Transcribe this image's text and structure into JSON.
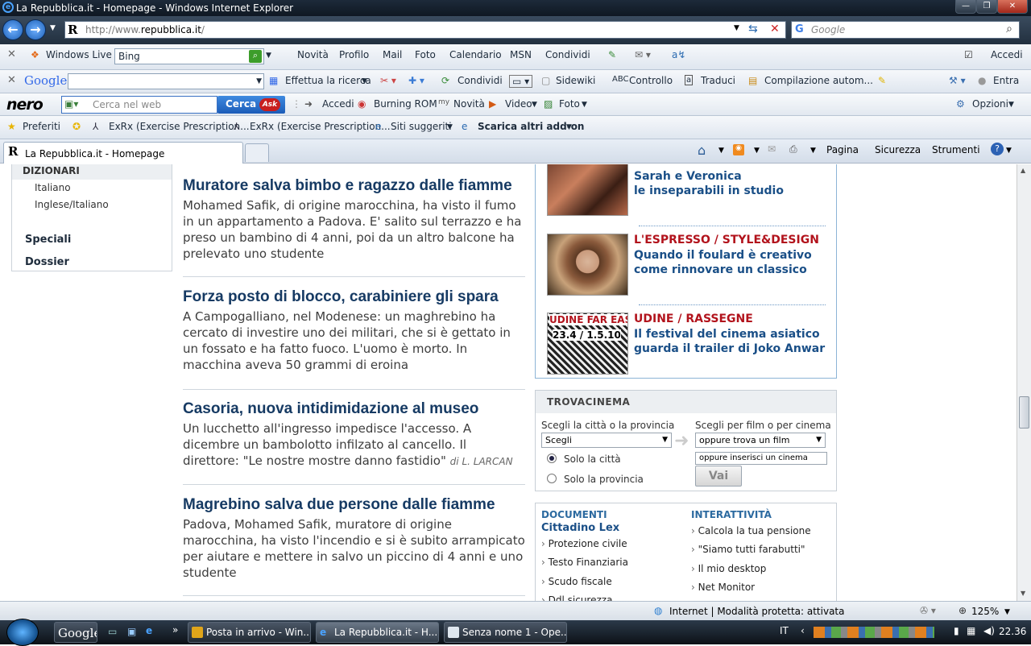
{
  "window": {
    "title": "La Repubblica.it - Homepage - Windows Internet Explorer"
  },
  "address": {
    "prefix": "http://www.",
    "domain": "repubblica.it",
    "suffix": "/"
  },
  "search": {
    "placeholder": "Google"
  },
  "toolbar_live": {
    "brand": "Windows Live",
    "search_value": "Bing",
    "items": [
      "Novità",
      "Profilo",
      "Mail",
      "Foto",
      "Calendario",
      "MSN",
      "Condividi"
    ],
    "accedi": "Accedi"
  },
  "toolbar_google": {
    "brand": "Google",
    "items": [
      "Effettua la ricerca",
      "Condividi",
      "Sidewiki",
      "Controllo",
      "Traduci",
      "Compilazione autom..."
    ],
    "entra": "Entra"
  },
  "toolbar_nero": {
    "brand": "nero",
    "placeholder": "Cerca nel web",
    "button": "Cerca",
    "ask": "Ask",
    "items": [
      "Accedi",
      "Burning ROM",
      "Novità",
      "Video",
      "Foto"
    ],
    "opzioni": "Opzioni"
  },
  "favorites": {
    "label": "Preferiti",
    "items": [
      "ExRx (Exercise Prescription...",
      "ExRx (Exercise Prescription...",
      "Siti suggeriti",
      "Scarica altri add-on"
    ]
  },
  "tabs": {
    "active": "La Repubblica.it - Homepage"
  },
  "command_bar": {
    "items": [
      "Pagina",
      "Sicurezza",
      "Strumenti"
    ]
  },
  "sidebar": {
    "header": "DIZIONARI",
    "sub": [
      "Italiano",
      "Inglese/Italiano"
    ],
    "main": [
      "Speciali",
      "Dossier"
    ]
  },
  "stories": [
    {
      "title": "Muratore salva bimbo e ragazzo dalle fiamme",
      "text": "Mohamed Safik, di origine marocchina, ha visto il fumo in un appartamento a Padova. E' salito sul terrazzo e ha preso un bambino di 4 anni, poi da un altro balcone ha prelevato uno studente",
      "byline": ""
    },
    {
      "title": "Forza posto di blocco, carabiniere gli spara",
      "text": "A Campogalliano, nel Modenese: un maghrebino ha cercato di investire uno dei militari, che si è gettato in un fossato e ha fatto fuoco. L'uomo è morto. In macchina aveva 50 grammi di eroina",
      "byline": ""
    },
    {
      "title": "Casoria, nuova intidimidazione al museo",
      "text": "Un lucchetto all'ingresso impedisce l'accesso. A dicembre un bambolotto infilzato al cancello. Il direttore: \"Le nostre mostre danno fastidio\"",
      "byline": "di L. LARCAN"
    },
    {
      "title": "Magrebino salva due persone dalle fiamme",
      "text": "Padova, Mohamed Safik, muratore di origine marocchina, ha visto l'incendio e si è subito arrampicato per aiutare e mettere in salvo un piccino di 4 anni e uno studente",
      "byline": ""
    }
  ],
  "promo": [
    {
      "category": "",
      "lines": [
        "Sarah e Veronica",
        "le inseparabili in studio"
      ]
    },
    {
      "category": "L'ESPRESSO / STYLE&DESIGN",
      "lines": [
        "Quando il foulard è creativo",
        "come rinnovare un classico"
      ]
    },
    {
      "category": "UDINE / RASSEGNE",
      "lines": [
        "Il festival del cinema asiatico",
        "guarda il trailer di Joko Anwar"
      ],
      "thumb_text": "UDINE FAR EAS",
      "thumb_date": "23.4 / 1.5.10"
    }
  ],
  "cinema": {
    "header": "TROVACINEMA",
    "city_label": "Scegli la città o la provincia",
    "city_select": "Scegli",
    "radio_city": "Solo la città",
    "radio_province": "Solo la provincia",
    "film_label": "Scegli per film o per cinema",
    "film_select": "oppure trova un film",
    "cinema_input": "oppure inserisci un cinema",
    "button": "Vai"
  },
  "docs": {
    "left_header": "DOCUMENTI",
    "left_sub": "Cittadino Lex",
    "left_items": [
      "Protezione civile",
      "Testo Finanziaria",
      "Scudo fiscale",
      "Ddl sicurezza"
    ],
    "right_header": "INTERATTIVITÀ",
    "right_items": [
      "Calcola la tua pensione",
      "\"Siamo tutti farabutti\"",
      "Il mio desktop",
      "Net Monitor"
    ]
  },
  "status": {
    "zone": "Internet | Modalità protetta: attivata",
    "zoom": "125%"
  },
  "taskbar": {
    "items": [
      "Posta in arrivo - Win...",
      "La Repubblica.it - H...",
      "Senza nome 1 - Ope..."
    ],
    "quick_launch": "Google",
    "lang": "IT",
    "clock": "22.36"
  },
  "colors": {
    "headline": "#163a63",
    "promo_category": "#b2131c",
    "promo_text": "#1a4f87",
    "titlebar": "#1d2a3a"
  }
}
